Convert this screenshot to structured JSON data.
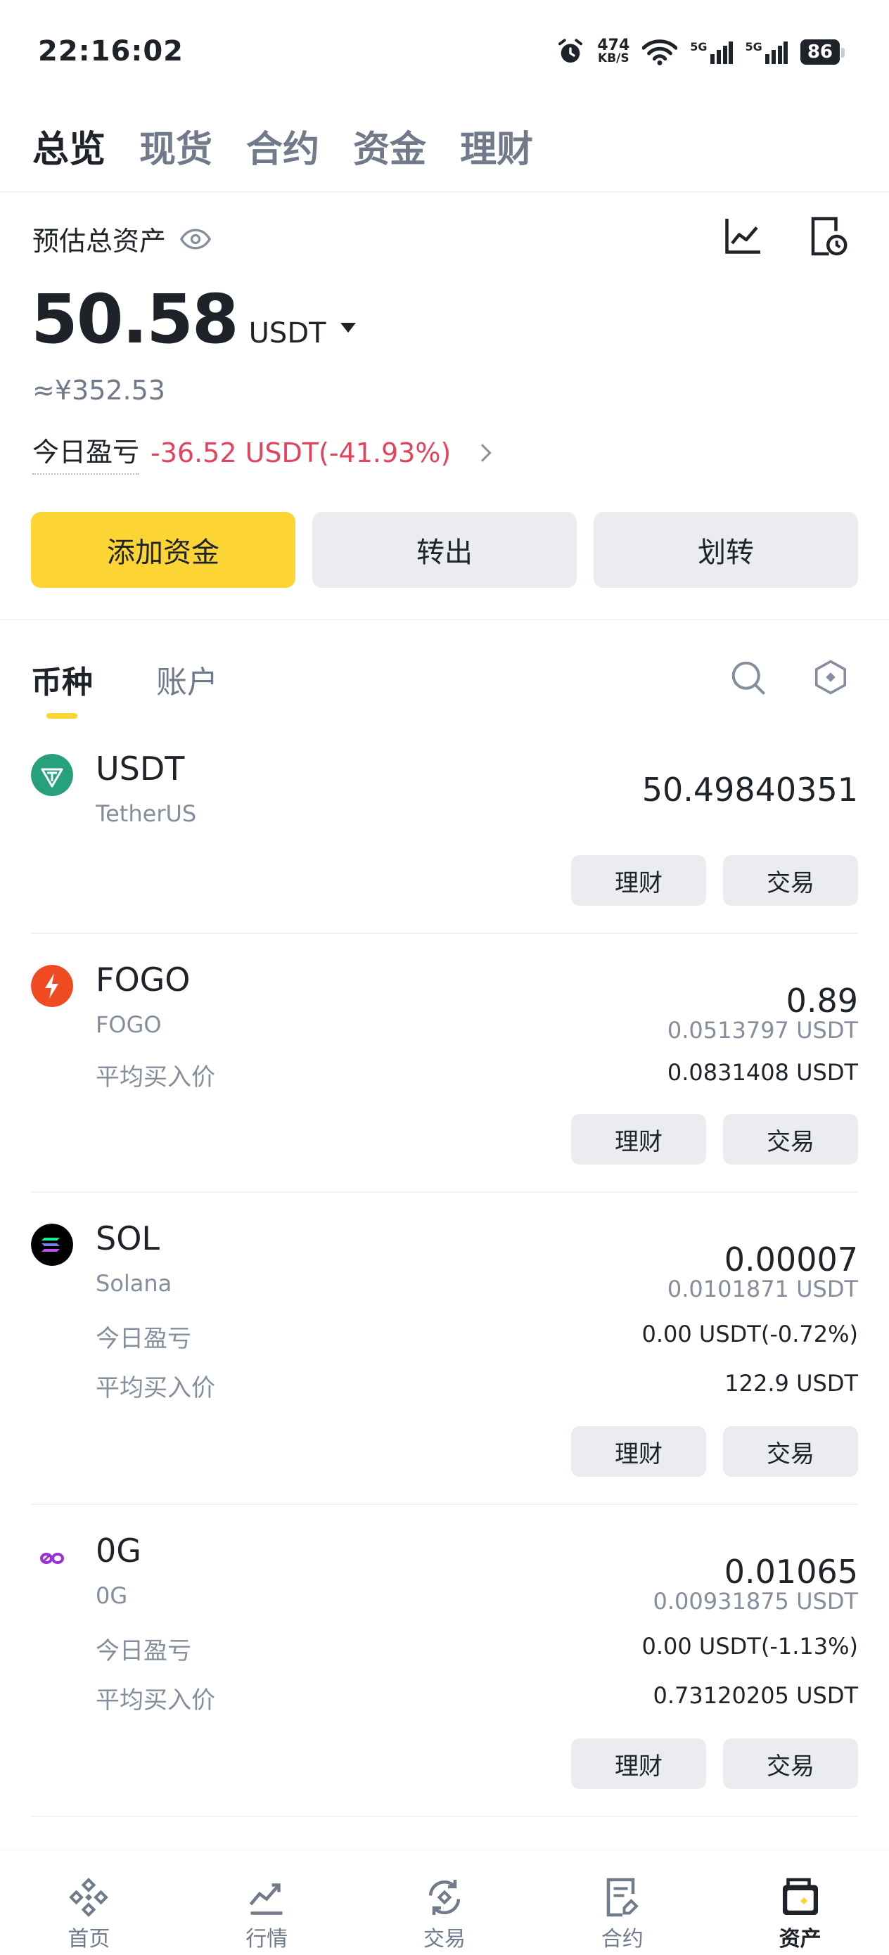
{
  "status_bar": {
    "time": "22:16:02",
    "net_speed_value": "474",
    "net_speed_unit": "KB/S",
    "signal1": "5G",
    "signal2": "5G",
    "battery": "86",
    "icons": [
      "alarm-icon",
      "wifi-icon",
      "signal-icon",
      "signal-icon",
      "battery-icon"
    ]
  },
  "top_tabs": [
    {
      "label": "总览",
      "active": true
    },
    {
      "label": "现货",
      "active": false
    },
    {
      "label": "合约",
      "active": false
    },
    {
      "label": "资金",
      "active": false
    },
    {
      "label": "理财",
      "active": false
    }
  ],
  "overview": {
    "estimated_label": "预估总资产",
    "balance": "50.58",
    "unit": "USDT",
    "cny_equivalent": "≈¥352.53",
    "pnl_label": "今日盈亏",
    "pnl_value": "-36.52 USDT(-41.93%)",
    "pnl_color": "#e2445c"
  },
  "actions": {
    "deposit": "添加资金",
    "withdraw": "转出",
    "transfer": "划转"
  },
  "sub_tabs": [
    {
      "label": "币种",
      "active": true
    },
    {
      "label": "账户",
      "active": false
    }
  ],
  "assets": [
    {
      "symbol": "USDT",
      "name": "TetherUS",
      "amount": "50.49840351",
      "logo_color": "#26a17b"
    },
    {
      "symbol": "FOGO",
      "name": "FOGO",
      "amount": "0.89",
      "value_usdt": "0.0513797 USDT",
      "avg_label": "平均买入价",
      "avg_value": "0.0831408 USDT",
      "logo_color": "#f04a23"
    },
    {
      "symbol": "SOL",
      "name": "Solana",
      "amount": "0.00007",
      "value_usdt": "0.0101871 USDT",
      "pnl_label": "今日盈亏",
      "pnl_value": "0.00 USDT(-0.72%)",
      "avg_label": "平均买入价",
      "avg_value": "122.9 USDT",
      "logo_color": "#000000"
    },
    {
      "symbol": "0G",
      "name": "0G",
      "amount": "0.01065",
      "value_usdt": "0.00931875 USDT",
      "pnl_label": "今日盈亏",
      "pnl_value": "0.00 USDT(-1.13%)",
      "avg_label": "平均买入价",
      "avg_value": "0.73120205 USDT",
      "logo_color": "#9b2fd8"
    }
  ],
  "asset_buttons": {
    "earn": "理财",
    "trade": "交易"
  },
  "bottom_nav": [
    {
      "label": "首页",
      "icon": "home-icon",
      "active": false
    },
    {
      "label": "行情",
      "icon": "markets-icon",
      "active": false
    },
    {
      "label": "交易",
      "icon": "trade-icon",
      "active": false
    },
    {
      "label": "合约",
      "icon": "futures-icon",
      "active": false
    },
    {
      "label": "资产",
      "icon": "wallet-icon",
      "active": true
    }
  ],
  "colors": {
    "accent": "#fcd535",
    "text": "#1e2329",
    "muted": "#848e9c",
    "negative": "#e2445c"
  }
}
